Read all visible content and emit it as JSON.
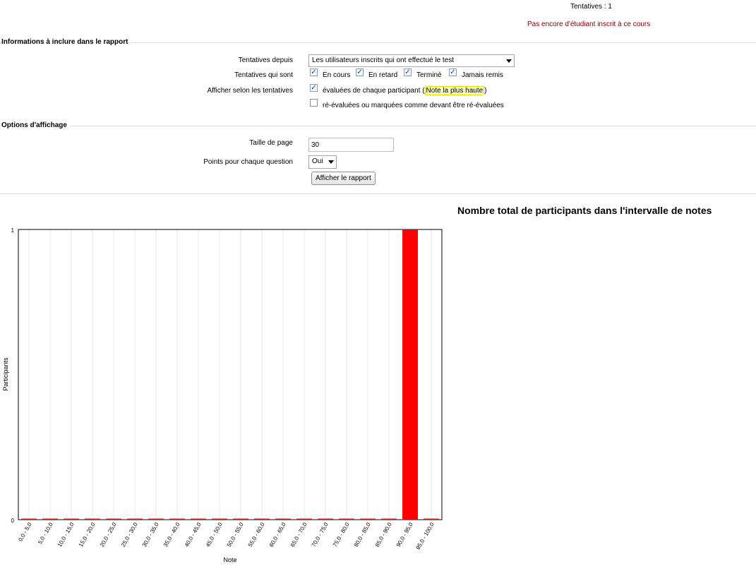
{
  "summary": {
    "attempts": "Tentatives : 1",
    "notice": "Pas encore d'étudiant inscrit à ce cours"
  },
  "report_info": {
    "legend": "Informations à inclure dans le rapport",
    "attempts_from_label": "Tentatives depuis",
    "attempts_from_value": "Les utilisateurs inscrits qui ont effectué le test",
    "attempts_that_are_label": "Tentatives qui sont",
    "states": [
      {
        "label": "En cours",
        "checked": true
      },
      {
        "label": "En retard",
        "checked": true
      },
      {
        "label": "Terminé",
        "checked": true
      },
      {
        "label": "Jamais remis",
        "checked": true
      }
    ],
    "show_by_label": "Afficher selon les tentatives",
    "graded_text": "évaluées de chaque participant (",
    "graded_highlight": "Note la plus haute",
    "graded_close": ")",
    "regraded_text": "ré-évaluées ou marquées comme devant être ré-évaluées"
  },
  "display_options": {
    "legend": "Options d'affichage",
    "page_size_label": "Taille de page",
    "page_size_value": "30",
    "marks_label": "Points pour chaque question",
    "marks_value": "Oui",
    "submit_label": "Afficher le rapport"
  },
  "chart_data": {
    "type": "bar",
    "title": "Nombre total de participants dans l'intervalle de notes",
    "xlabel": "Note",
    "ylabel": "Participants",
    "ylim": [
      0,
      1
    ],
    "yticks": [
      "0",
      "1"
    ],
    "categories": [
      "0,0 - 5,0",
      "5,0 - 10,0",
      "10,0 - 15,0",
      "15,0 - 20,0",
      "20,0 - 25,0",
      "25,0 - 30,0",
      "30,0 - 35,0",
      "35,0 - 40,0",
      "40,0 - 45,0",
      "45,0 - 50,0",
      "50,0 - 55,0",
      "55,0 - 60,0",
      "60,0 - 65,0",
      "65,0 - 70,0",
      "70,0 - 75,0",
      "75,0 - 80,0",
      "80,0 - 85,0",
      "85,0 - 90,0",
      "90,0 - 95,0",
      "95,0 - 100,0"
    ],
    "values": [
      0,
      0,
      0,
      0,
      0,
      0,
      0,
      0,
      0,
      0,
      0,
      0,
      0,
      0,
      0,
      0,
      0,
      0,
      1,
      0
    ],
    "bar_color": "#ff0000",
    "grid": true
  }
}
